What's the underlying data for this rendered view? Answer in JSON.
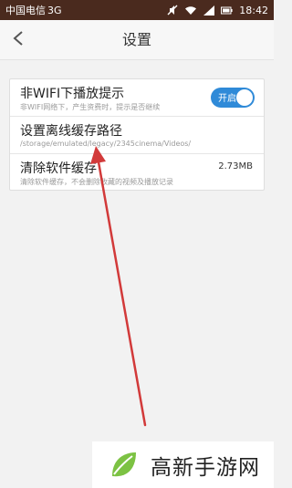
{
  "status_bar": {
    "carrier": "中国电信",
    "network": "3G",
    "time": "18:42",
    "icons": [
      "mute-icon",
      "wifi-icon",
      "signal-icon",
      "battery-icon"
    ]
  },
  "header": {
    "title": "设置",
    "back_icon": "chevron-left-icon"
  },
  "settings": {
    "items": [
      {
        "title": "非WIFI下播放提示",
        "subtitle": "非WIFI网络下，产生资费时，提示是否继续",
        "toggle_label": "开启"
      },
      {
        "title": "设置离线缓存路径",
        "subtitle": "/storage/emulated/legacy/2345cinema/Videos/"
      },
      {
        "title": "清除软件缓存",
        "subtitle": "清除软件缓存，不会删除收藏的视频及播放记录",
        "value": "2.73MB"
      }
    ]
  },
  "watermark": {
    "text": "高新手游网"
  },
  "colors": {
    "status_bar": "#4a2a1e",
    "toggle_on": "#2f8ad8",
    "arrow": "#d23a3a",
    "logo_green": "#7cc243"
  }
}
